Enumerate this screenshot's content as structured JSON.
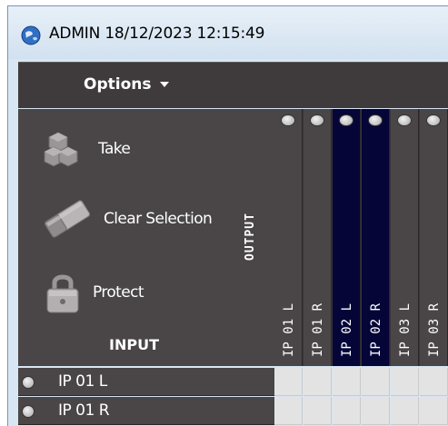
{
  "window": {
    "title": "ADMIN 18/12/2023 12:15:49"
  },
  "menu": {
    "options_label": "Options"
  },
  "actions": [
    {
      "label": "Take",
      "icon": "cubes-icon"
    },
    {
      "label": "Clear Selection",
      "icon": "eraser-icon"
    },
    {
      "label": "Protect",
      "icon": "padlock-icon"
    }
  ],
  "labels": {
    "output": "OUTPUT",
    "input": "INPUT"
  },
  "outputs": [
    {
      "label": "IP 01 L",
      "selected": false
    },
    {
      "label": "IP 01 R",
      "selected": false
    },
    {
      "label": "IP 02 L",
      "selected": true
    },
    {
      "label": "IP 02 R",
      "selected": true
    },
    {
      "label": "IP 03 L",
      "selected": false
    },
    {
      "label": "IP 03 R",
      "selected": false
    }
  ],
  "inputs": [
    {
      "label": "IP 01 L"
    },
    {
      "label": "IP 01 R"
    }
  ],
  "colors": {
    "panel": "#4a4647",
    "selected_column": "#050538",
    "grid_cell": "#e3e3e3"
  }
}
